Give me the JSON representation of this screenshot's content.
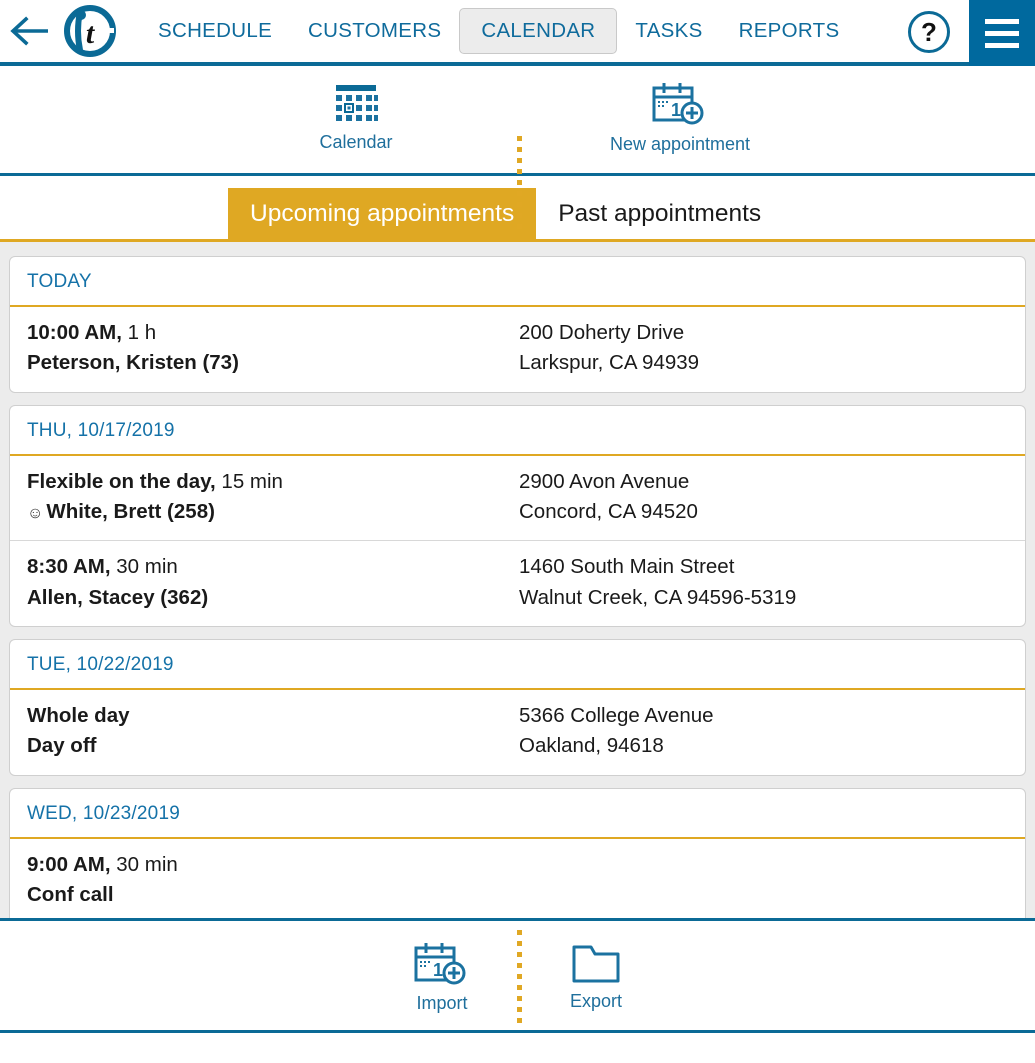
{
  "topbar": {
    "back_icon": "back-arrow-icon",
    "logo_letter": "t",
    "nav": [
      {
        "label": "SCHEDULE",
        "active": false
      },
      {
        "label": "CUSTOMERS",
        "active": false
      },
      {
        "label": "CALENDAR",
        "active": true
      },
      {
        "label": "TASKS",
        "active": false
      },
      {
        "label": "REPORTS",
        "active": false
      }
    ],
    "help_label": "?",
    "menu_icon": "hamburger-menu-icon"
  },
  "toolbar": {
    "items": [
      {
        "label": "Calendar",
        "icon": "calendar-grid-icon"
      },
      {
        "label": "New appointment",
        "icon": "calendar-add-icon"
      }
    ]
  },
  "tabs": [
    {
      "label": "Upcoming appointments",
      "active": true
    },
    {
      "label": "Past appointments",
      "active": false
    }
  ],
  "groups": [
    {
      "date_label": "TODAY",
      "appointments": [
        {
          "time": "10:00 AM,",
          "duration": " 1 h",
          "has_smiley": false,
          "title": "Peterson, Kristen (73)",
          "address_line1": "200 Doherty Drive",
          "address_line2": "Larkspur, CA 94939"
        }
      ]
    },
    {
      "date_label": "THU, 10/17/2019",
      "appointments": [
        {
          "time": "Flexible on the day,",
          "duration": " 15 min",
          "has_smiley": true,
          "smiley": "☺",
          "title": "White, Brett (258)",
          "address_line1": "2900 Avon Avenue",
          "address_line2": "Concord, CA 94520"
        },
        {
          "time": "8:30 AM,",
          "duration": " 30 min",
          "has_smiley": false,
          "title": "Allen, Stacey (362)",
          "address_line1": "1460 South Main Street",
          "address_line2": "Walnut Creek, CA 94596-5319"
        }
      ]
    },
    {
      "date_label": "TUE, 10/22/2019",
      "appointments": [
        {
          "time": "Whole day",
          "duration": "",
          "has_smiley": false,
          "title": "Day off",
          "address_line1": "5366 College Avenue",
          "address_line2": "Oakland, 94618"
        }
      ]
    },
    {
      "date_label": "WED, 10/23/2019",
      "appointments": [
        {
          "time": "9:00 AM,",
          "duration": " 30 min",
          "has_smiley": false,
          "title": "Conf call",
          "address_line1": "",
          "address_line2": ""
        }
      ]
    }
  ],
  "bottombar": {
    "items": [
      {
        "label": "Import",
        "icon": "calendar-add-icon"
      },
      {
        "label": "Export",
        "icon": "folder-icon"
      }
    ]
  },
  "colors": {
    "brand_blue": "#0b6a96",
    "link_blue": "#1572a8",
    "accent_gold": "#dfa823",
    "menu_blue": "#00699e",
    "page_bg": "#ececec",
    "text_dark": "#1a1a1a"
  }
}
